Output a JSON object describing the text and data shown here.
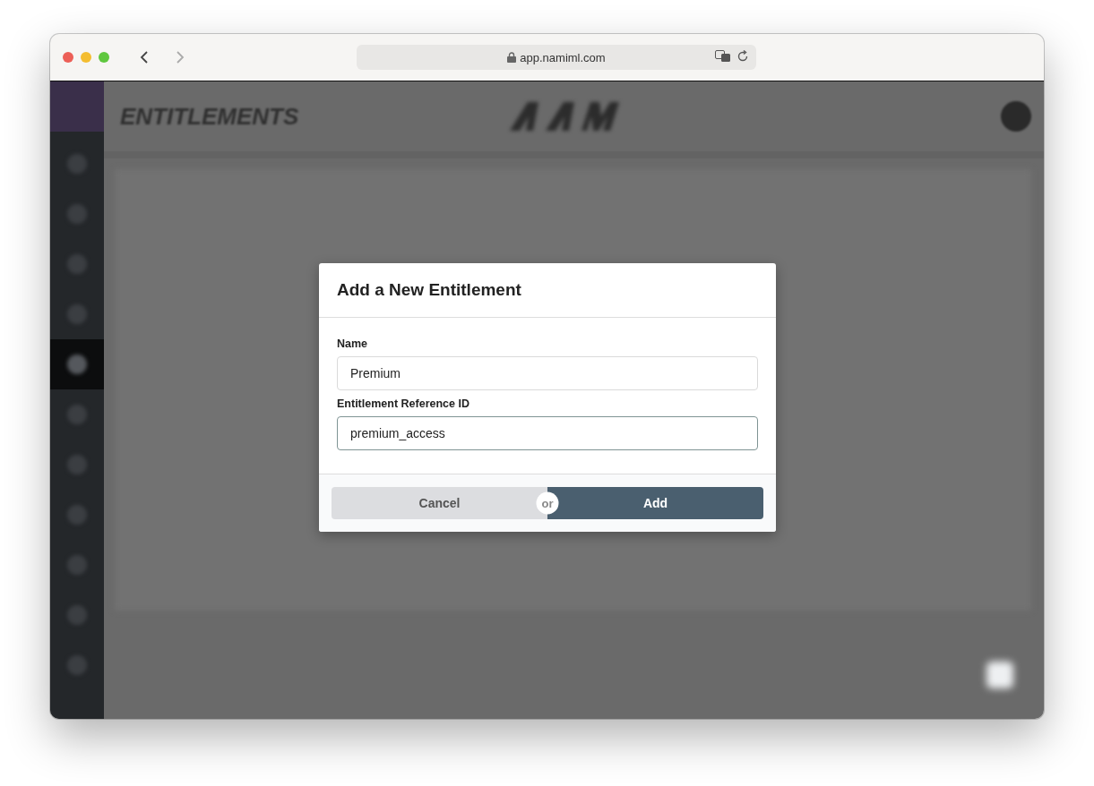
{
  "browser": {
    "url": "app.namiml.com"
  },
  "page": {
    "title": "ENTITLEMENTS"
  },
  "sidebar": {
    "items": [
      {
        "selected": false
      },
      {
        "selected": false
      },
      {
        "selected": false
      },
      {
        "selected": false
      },
      {
        "selected": true
      },
      {
        "selected": false
      },
      {
        "selected": false
      },
      {
        "selected": false
      },
      {
        "selected": false
      },
      {
        "selected": false
      },
      {
        "selected": false
      }
    ]
  },
  "dialog": {
    "title": "Add a New Entitlement",
    "fields": [
      {
        "label": "Name",
        "value": "Premium",
        "focused": false
      },
      {
        "label": "Entitlement Reference ID",
        "value": "premium_access",
        "focused": true
      }
    ],
    "cancel": "Cancel",
    "separator": "or",
    "confirm": "Add"
  }
}
